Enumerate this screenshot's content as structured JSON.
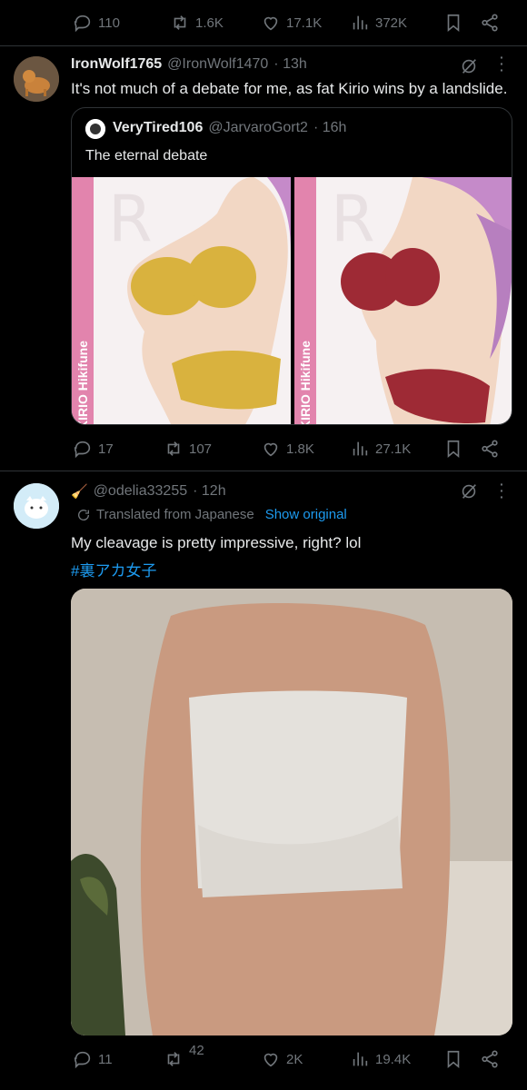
{
  "top_actions": {
    "replies": "110",
    "reposts": "1.6K",
    "likes": "17.1K",
    "views": "372K"
  },
  "post1": {
    "author_name": "IronWolf1765",
    "author_handle": "@IronWolf1470",
    "time": "· 13h",
    "text": "It's not much of a debate for me, as fat Kirio wins by a landslide.",
    "quote": {
      "author_name": "VeryTired106",
      "author_handle": "@JarvaroGort2",
      "time": "· 16h",
      "text": "The eternal debate",
      "image_left_label": "KIRIO Hikifune",
      "image_right_label": "KIRIO Hikifune"
    },
    "actions": {
      "replies": "17",
      "reposts": "107",
      "likes": "1.8K",
      "views": "27.1K"
    }
  },
  "post2": {
    "author_handle": "@odelia33255",
    "time": "· 12h",
    "translated_label": "Translated from Japanese",
    "show_original": "Show original",
    "text": "My cleavage is pretty impressive, right? lol",
    "hashtag": "#裏アカ女子",
    "actions": {
      "replies": "11",
      "reposts": "42",
      "likes": "2K",
      "views": "19.4K"
    }
  },
  "colors": {
    "muted": "#71767b",
    "link": "#1d9bf0",
    "background": "#000000",
    "divider": "#2f3336"
  }
}
